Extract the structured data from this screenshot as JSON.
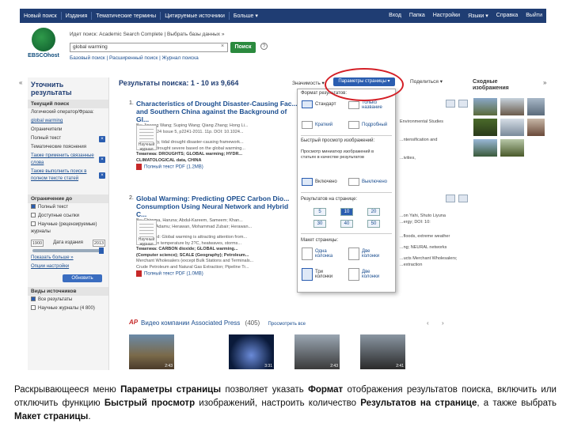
{
  "topnav": {
    "left": [
      "Новый поиск",
      "Издания",
      "Тематические термины",
      "Цитируемые источники",
      "Больше ▾"
    ],
    "right": [
      "Вход",
      "Папка",
      "Настройки",
      "Языки ▾",
      "Справка",
      "Выйти"
    ]
  },
  "header": {
    "logo_text": "EBSCOhost",
    "search_label": "Идет поиск: Academic Search Complete | Выбрать базы данных »",
    "search_value": "global warming",
    "search_button": "Поиск",
    "help": "?",
    "clear": "×",
    "links": "Базовый поиск | Расширенный поиск | Журнал поиска"
  },
  "left": {
    "collapse": "«",
    "title": "Уточнить результаты",
    "current_search": "Текущий поиск",
    "boolean_label": "Логический оператор/Фраза:",
    "boolean_value": "global warming",
    "limiters": "Ограничители",
    "fulltext": "Полный текст",
    "expanders": "Тематические пояснения",
    "expander1": "Также применить связанные слова",
    "expander2": "Также выполнить поиск в полном тексте статей",
    "limit_to": "Ограничение до",
    "limit_fulltext": "Полный текст",
    "limit_refs": "Доступные ссылки",
    "limit_peer": "Научные (рецензируемые) журналы",
    "year_from": "1900",
    "year_to": "2013",
    "date_label": "Дата издания",
    "show_more": "Показать больше »",
    "options": "Опции настройки",
    "update": "Обновить",
    "source_types": "Виды источников",
    "all_results": "Все результаты",
    "academic": "Научные журналы (4 800)"
  },
  "results": {
    "title": "Результаты поиска: 1 - 10 из 9,664",
    "relevance": "Значимость ▾",
    "page_options": "Параметры страницы ▾",
    "share": "Поделиться ▾",
    "items": [
      {
        "num": "1.",
        "title": "Characteristics of Drought Disaster-Causing Fac... and Southern China against the Background of Gl...",
        "authors": "By: Jinsong Wang; Suping Wang; Qiang Zhang; Hong Li...",
        "source": "2013, Vol. 24 Issue 5, p2241-2011. 11p. DOI: 10.1024...",
        "abstract1": "In this study, tidal drought disaster-causing framework...",
        "abstract2": "degree of drought severe based on the global warming...",
        "subjects1": "Тематика: DROUGHTS; GLOBAL warming; HYDR...",
        "subjects2": "CLIMATOLOGICAL data, CHINA",
        "pdf": "Полный текст PDF (1.2MB)",
        "thumb_label": "Научный журнал"
      },
      {
        "num": "2.",
        "title": "Global Warming: Predicting OPEC Carbon Dio... Consumption Using Neural Network and Hybrid C...",
        "authors": "By: Chiroma, Haruna; Abdul-Kareem, Sameem; Khan...",
        "source": "Abubakar Adamu; Herawan, Mohammad Zubair; Herawan...",
        "abstract1": "Background: Global warming is attracting attention from...",
        "abstract2": "increases in temperature by 2?C, heatwaves, storms...",
        "subjects1": "Тематика: CARBON dioxide; GLOBAL warming...",
        "subjects2": "(Computer science); SCALE (Geography); Petroleum...",
        "extra1": "Merchant Wholesalers (except Bulk Stations and Terminals...",
        "extra2": "Crude Petroleum and Natural Gas Extraction; Pipeline Tr...",
        "pdf": "Полный текст PDF (1.0MB)",
        "thumb_label": "Научный журнал"
      }
    ]
  },
  "dropdown": {
    "format_label": "Формат результатов:",
    "format_standard": "Стандарт",
    "format_title_only": "Только название",
    "format_brief": "Краткий",
    "format_detailed": "Подробный",
    "preview_label": "Быстрый просмотр изображений:",
    "preview_desc": "Просмотр миниатюр изображений в статьях в качестве результатов",
    "preview_on": "Включено",
    "preview_off": "Выключено",
    "per_page_label": "Результатов на странице:",
    "per_page": [
      "5",
      "10",
      "20",
      "30",
      "40",
      "50"
    ],
    "layout_label": "Макет страницы:",
    "layout_one": "Одна колонка",
    "layout_two": "Две колонки",
    "layout_three": "Три колонки",
    "layout_two_b": "Две колонки"
  },
  "peek": {
    "r1a": "Environmental Studies",
    "r1b": "...ntensification and",
    "r1c": "...ivities,",
    "r2a": "...on Yahi, Shuto Liyuna",
    "r2b": "...ergy; DOI: 10:",
    "r2c": "...floods, extreme weather",
    "r2d": "...ng; NEURAL networks",
    "r2e": "...ucts Merchant Wholesalers;",
    "r2f": "...extraction"
  },
  "right": {
    "title": "Сходные изображения",
    "expand": "»"
  },
  "video": {
    "ap": "AP",
    "title": "Видео компании Associated Press",
    "count": "(405)",
    "view": "Просмотреть все",
    "durations": [
      "2:43",
      "3:31",
      "2:43",
      "2:41"
    ],
    "prev": "‹",
    "next": "›"
  },
  "caption": {
    "p1": "Раскрывающееся меню ",
    "b1": "Параметры страницы",
    "p2": " позволяет указать ",
    "b2": "Формат",
    "p3": " отображения результатов поиска, включить или отключить функцию ",
    "b3": "Быстрый просмотр",
    "p4": " изображений, настроить количество ",
    "b4": "Результатов на странице",
    "p5": ", а также выбрать ",
    "b5": "Макет страницы",
    "p6": "."
  },
  "colors": {
    "nav": "#1f3d73",
    "accent": "#2a5db0",
    "highlight": "#d41f26",
    "button": "#2b8a3e"
  }
}
